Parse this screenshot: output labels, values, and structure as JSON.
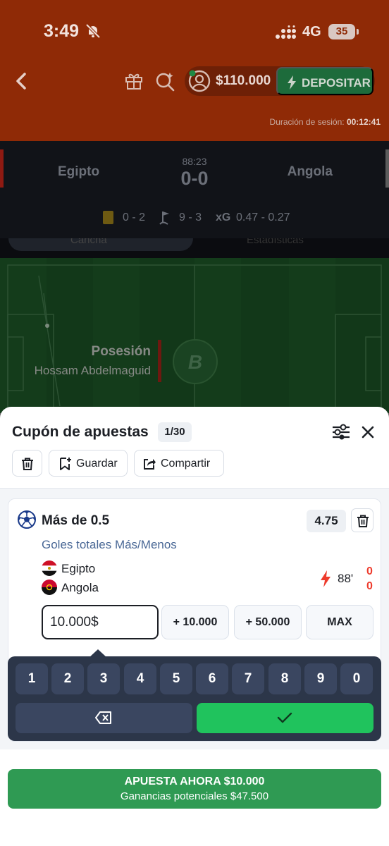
{
  "status_bar": {
    "time": "3:49",
    "network": "4G",
    "battery": "35"
  },
  "header": {
    "balance": "$110.000",
    "deposit_label": "DEPOSITAR",
    "session_label": "Duración de sesión:",
    "session_time": "00:12:41"
  },
  "match": {
    "home": "Egipto",
    "away": "Angola",
    "clock": "88:23",
    "score": "0-0",
    "cards": "0 - 2",
    "corners": "9 - 3",
    "xg_label": "xG",
    "xg": "0.47 - 0.27",
    "tab_left": "Cancha",
    "tab_right": "Estadísticas"
  },
  "pitch": {
    "event_label": "Posesión",
    "player": "Hossam Abdelmaguid"
  },
  "bet_slip": {
    "title": "Cupón de apuestas",
    "counter": "1/30",
    "save_label": "Guardar",
    "share_label": "Compartir",
    "bet": {
      "market": "Más de 0.5",
      "odds": "4.75",
      "market_type": "Goles totales Más/Menos",
      "home": "Egipto",
      "away": "Angola",
      "minute": "88'",
      "home_score": "0",
      "away_score": "0",
      "stake": "10.000$",
      "quick_1": "+ 10.000",
      "quick_2": "+ 50.000",
      "quick_max": "MAX"
    },
    "keypad": [
      "1",
      "2",
      "3",
      "4",
      "5",
      "6",
      "7",
      "8",
      "9",
      "0"
    ],
    "place_bet_label": "APUESTA AHORA $10.000",
    "potential_label": "Ganancias potenciales $47.500"
  },
  "colors": {
    "accent_orange": "#8f2a06",
    "deposit_green": "#1d6b3b",
    "confirm_green": "#20c35d",
    "place_bet_green": "#2f9a53",
    "score_red": "#ee3b2c"
  },
  "icons": [
    "back-icon",
    "gift-icon",
    "search-promo-icon",
    "avatar-icon",
    "bolt-icon",
    "yellow-card-icon",
    "corner-flag-icon",
    "settings-sliders-icon",
    "close-icon",
    "trash-icon",
    "bookmark-icon",
    "share-icon",
    "soccer-ball-icon",
    "flame-icon",
    "backspace-icon",
    "checkmark-icon"
  ]
}
